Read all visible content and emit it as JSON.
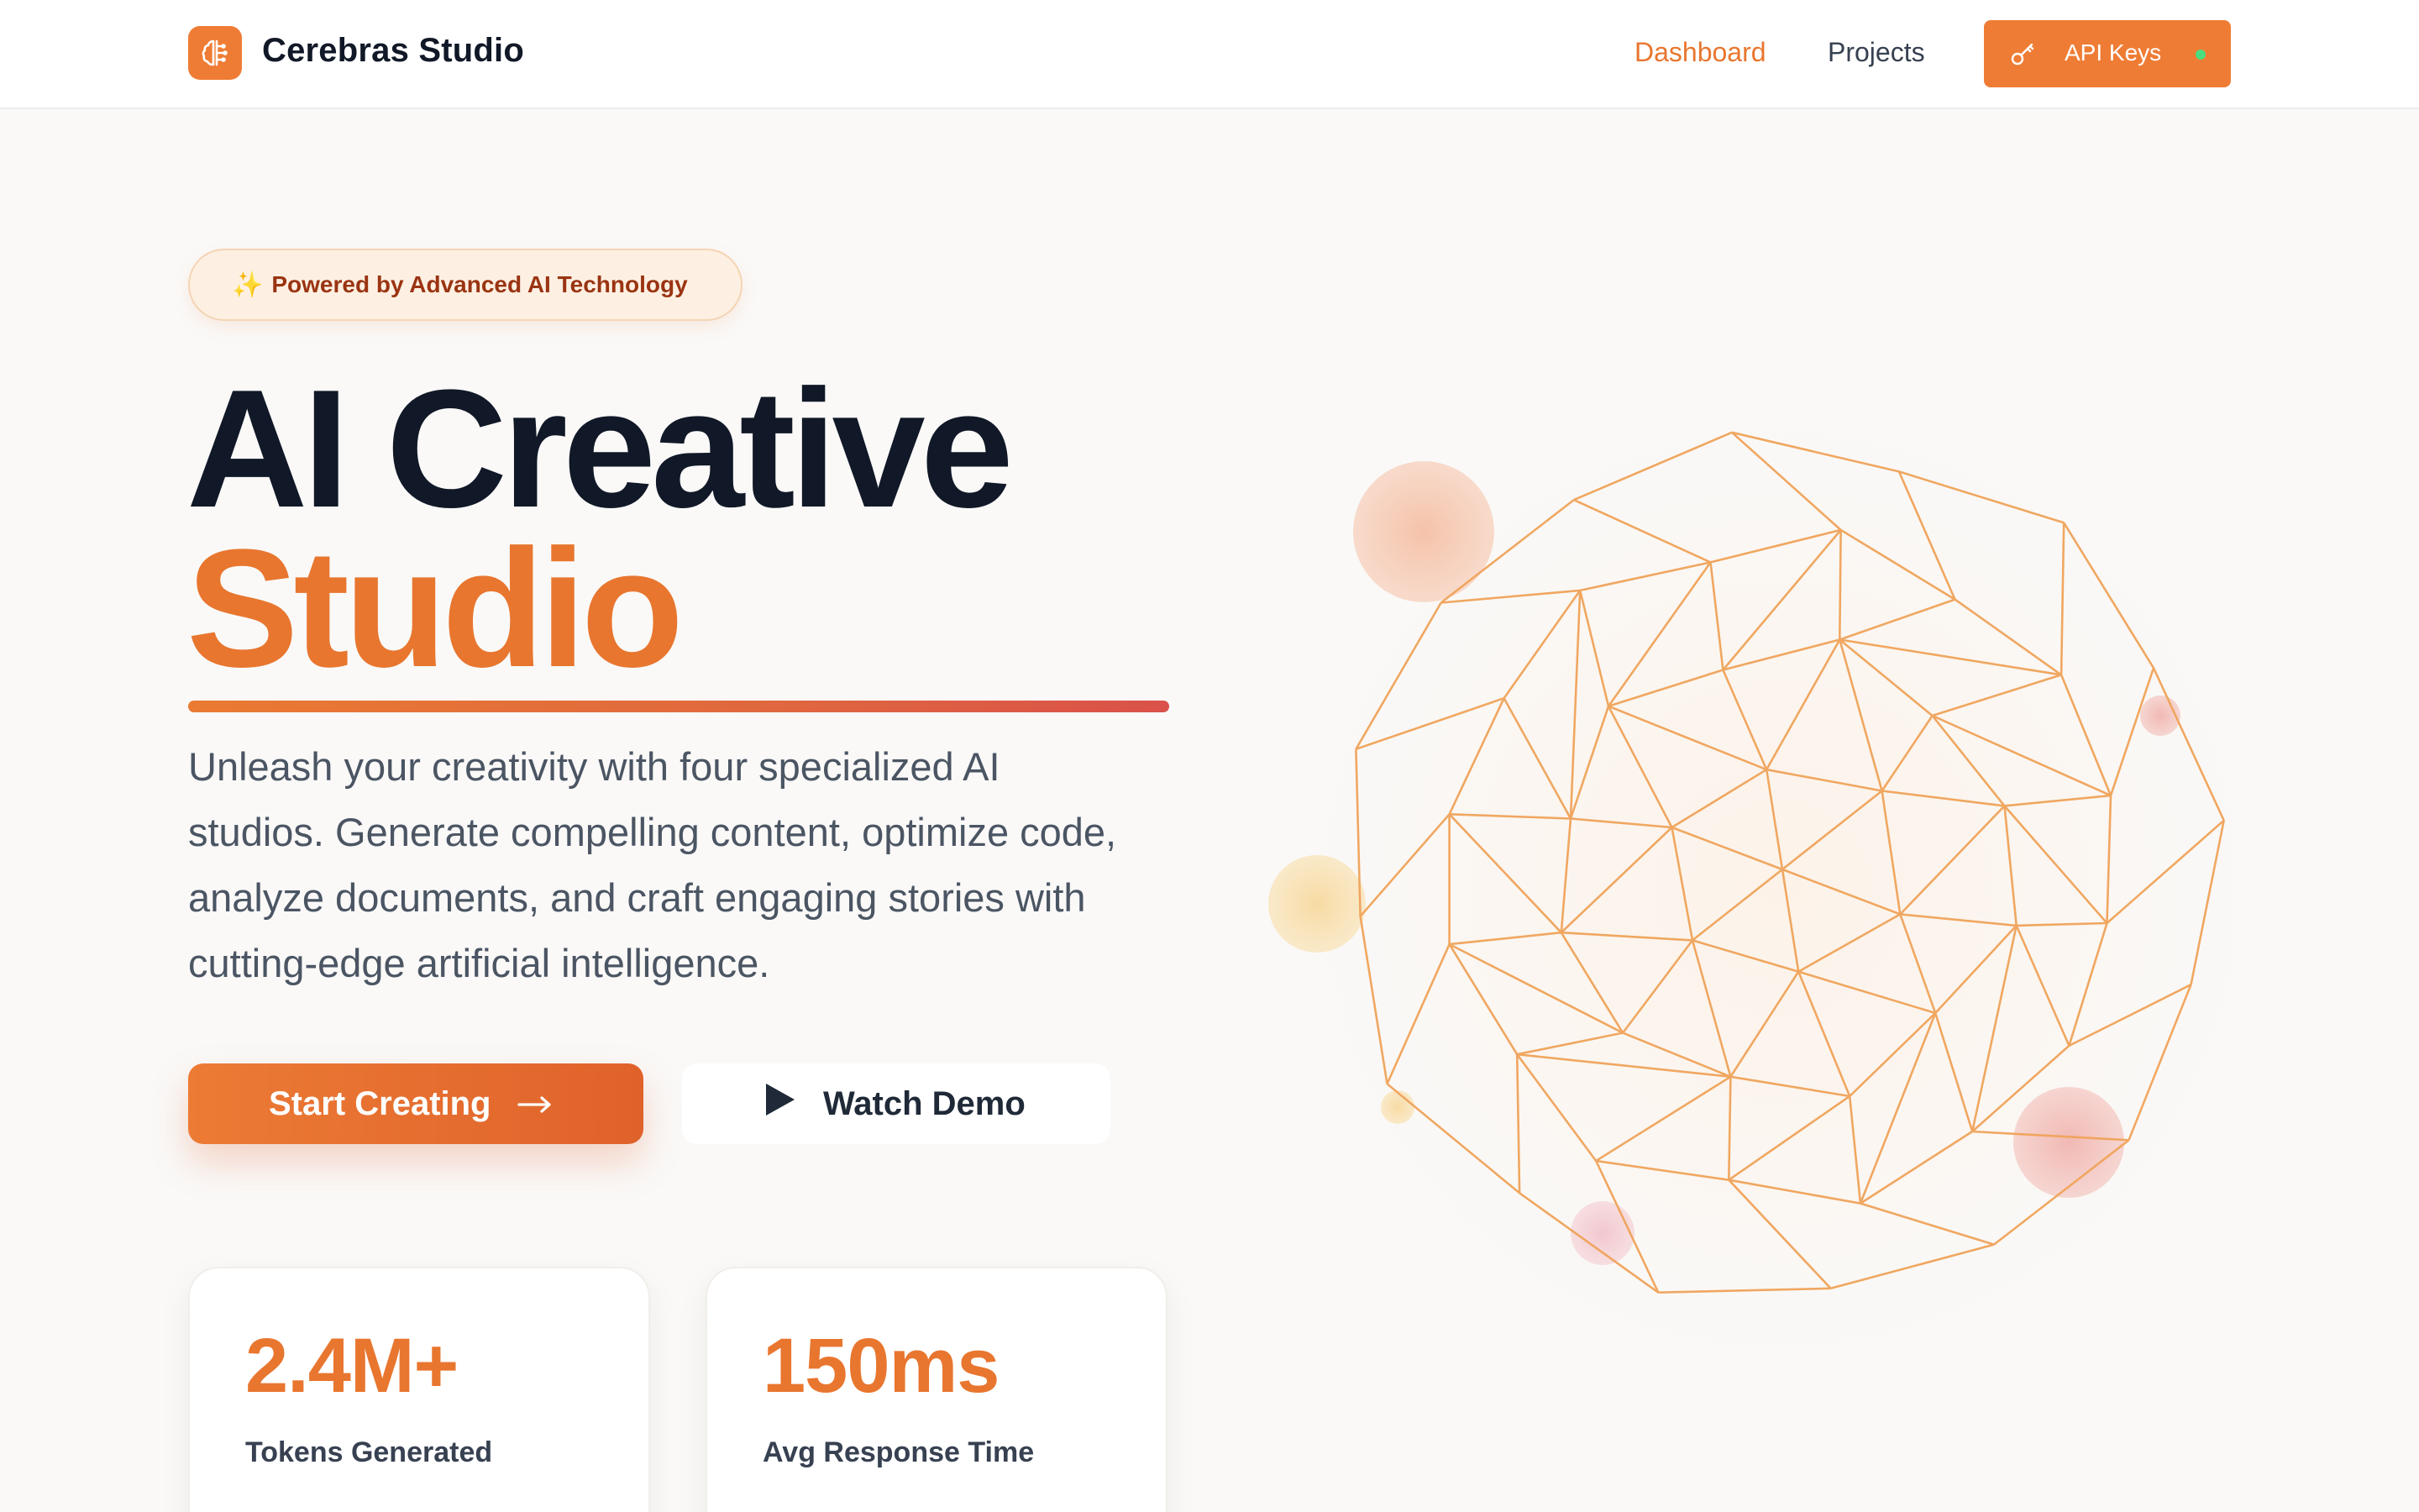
{
  "header": {
    "brand": "Cerebras Studio",
    "nav": [
      {
        "label": "Dashboard",
        "active": true
      },
      {
        "label": "Projects",
        "active": false
      }
    ],
    "api_button": {
      "label": "API Keys",
      "icon": "key-icon",
      "status": "online"
    }
  },
  "hero": {
    "badge": "Powered by Advanced AI Technology",
    "badge_icon": "sparkles-icon",
    "title_line1": "AI Creative",
    "title_line2": "Studio",
    "description": "Unleash your creativity with four specialized AI studios. Generate compelling content, optimize code, analyze documents, and craft engaging stories with cutting-edge artificial intelligence.",
    "primary_cta": "Start Creating",
    "secondary_cta": "Watch Demo"
  },
  "stats": [
    {
      "value": "2.4M+",
      "label": "Tokens Generated"
    },
    {
      "value": "150ms",
      "label": "Avg Response Time"
    }
  ],
  "colors": {
    "accent": "#e8762f",
    "accent_button": "#ef7c34",
    "heading": "#111827",
    "body_text": "#4b5563",
    "status_online": "#4ade80",
    "wireframe": "#f0a35a"
  }
}
